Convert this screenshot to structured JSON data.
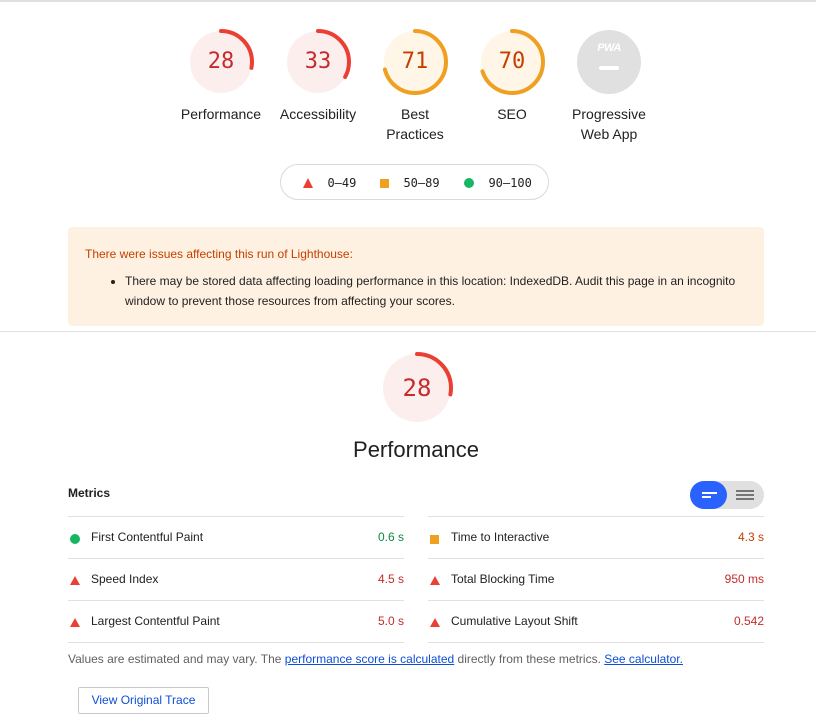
{
  "categories": [
    {
      "score": "28",
      "label_lines": [
        "Performance"
      ],
      "level": "bad"
    },
    {
      "score": "33",
      "label_lines": [
        "Accessibility"
      ],
      "level": "bad"
    },
    {
      "score": "71",
      "label_lines": [
        "Best",
        "Practices"
      ],
      "level": "average"
    },
    {
      "score": "70",
      "label_lines": [
        "SEO"
      ],
      "level": "average"
    },
    {
      "score": "",
      "badge_text": "PWA",
      "label_lines": [
        "Progressive",
        "Web App"
      ],
      "level": "na"
    }
  ],
  "legend": {
    "bad": "0–49",
    "average": "50–89",
    "good": "90–100"
  },
  "warning": {
    "title": "There were issues affecting this run of Lighthouse:",
    "items": [
      "There may be stored data affecting loading performance in this location: IndexedDB. Audit this page in an incognito window to prevent those resources from affecting your scores."
    ]
  },
  "performance": {
    "score": "28",
    "title": "Performance",
    "fraction": 0.28
  },
  "metrics": {
    "header": "Metrics",
    "left": [
      {
        "name": "First Contentful Paint",
        "value": "0.6 s",
        "level": "good"
      },
      {
        "name": "Speed Index",
        "value": "4.5 s",
        "level": "bad"
      },
      {
        "name": "Largest Contentful Paint",
        "value": "5.0 s",
        "level": "bad"
      }
    ],
    "right": [
      {
        "name": "Time to Interactive",
        "value": "4.3 s",
        "level": "average"
      },
      {
        "name": "Total Blocking Time",
        "value": "950 ms",
        "level": "bad"
      },
      {
        "name": "Cumulative Layout Shift",
        "value": "0.542",
        "level": "bad"
      }
    ]
  },
  "note": {
    "prefix": "Values are estimated and may vary. The ",
    "link1": "performance score is calculated",
    "middle": " directly from these metrics. ",
    "link2": "See calculator."
  },
  "trace_button": "View Original Trace",
  "colors": {
    "bad": "#eb3f34",
    "average": "#f0a020",
    "good": "#18b663",
    "bad_bg": "#fdeeee",
    "avg_bg": "#fff6e8",
    "na": "#e0e0e0"
  }
}
